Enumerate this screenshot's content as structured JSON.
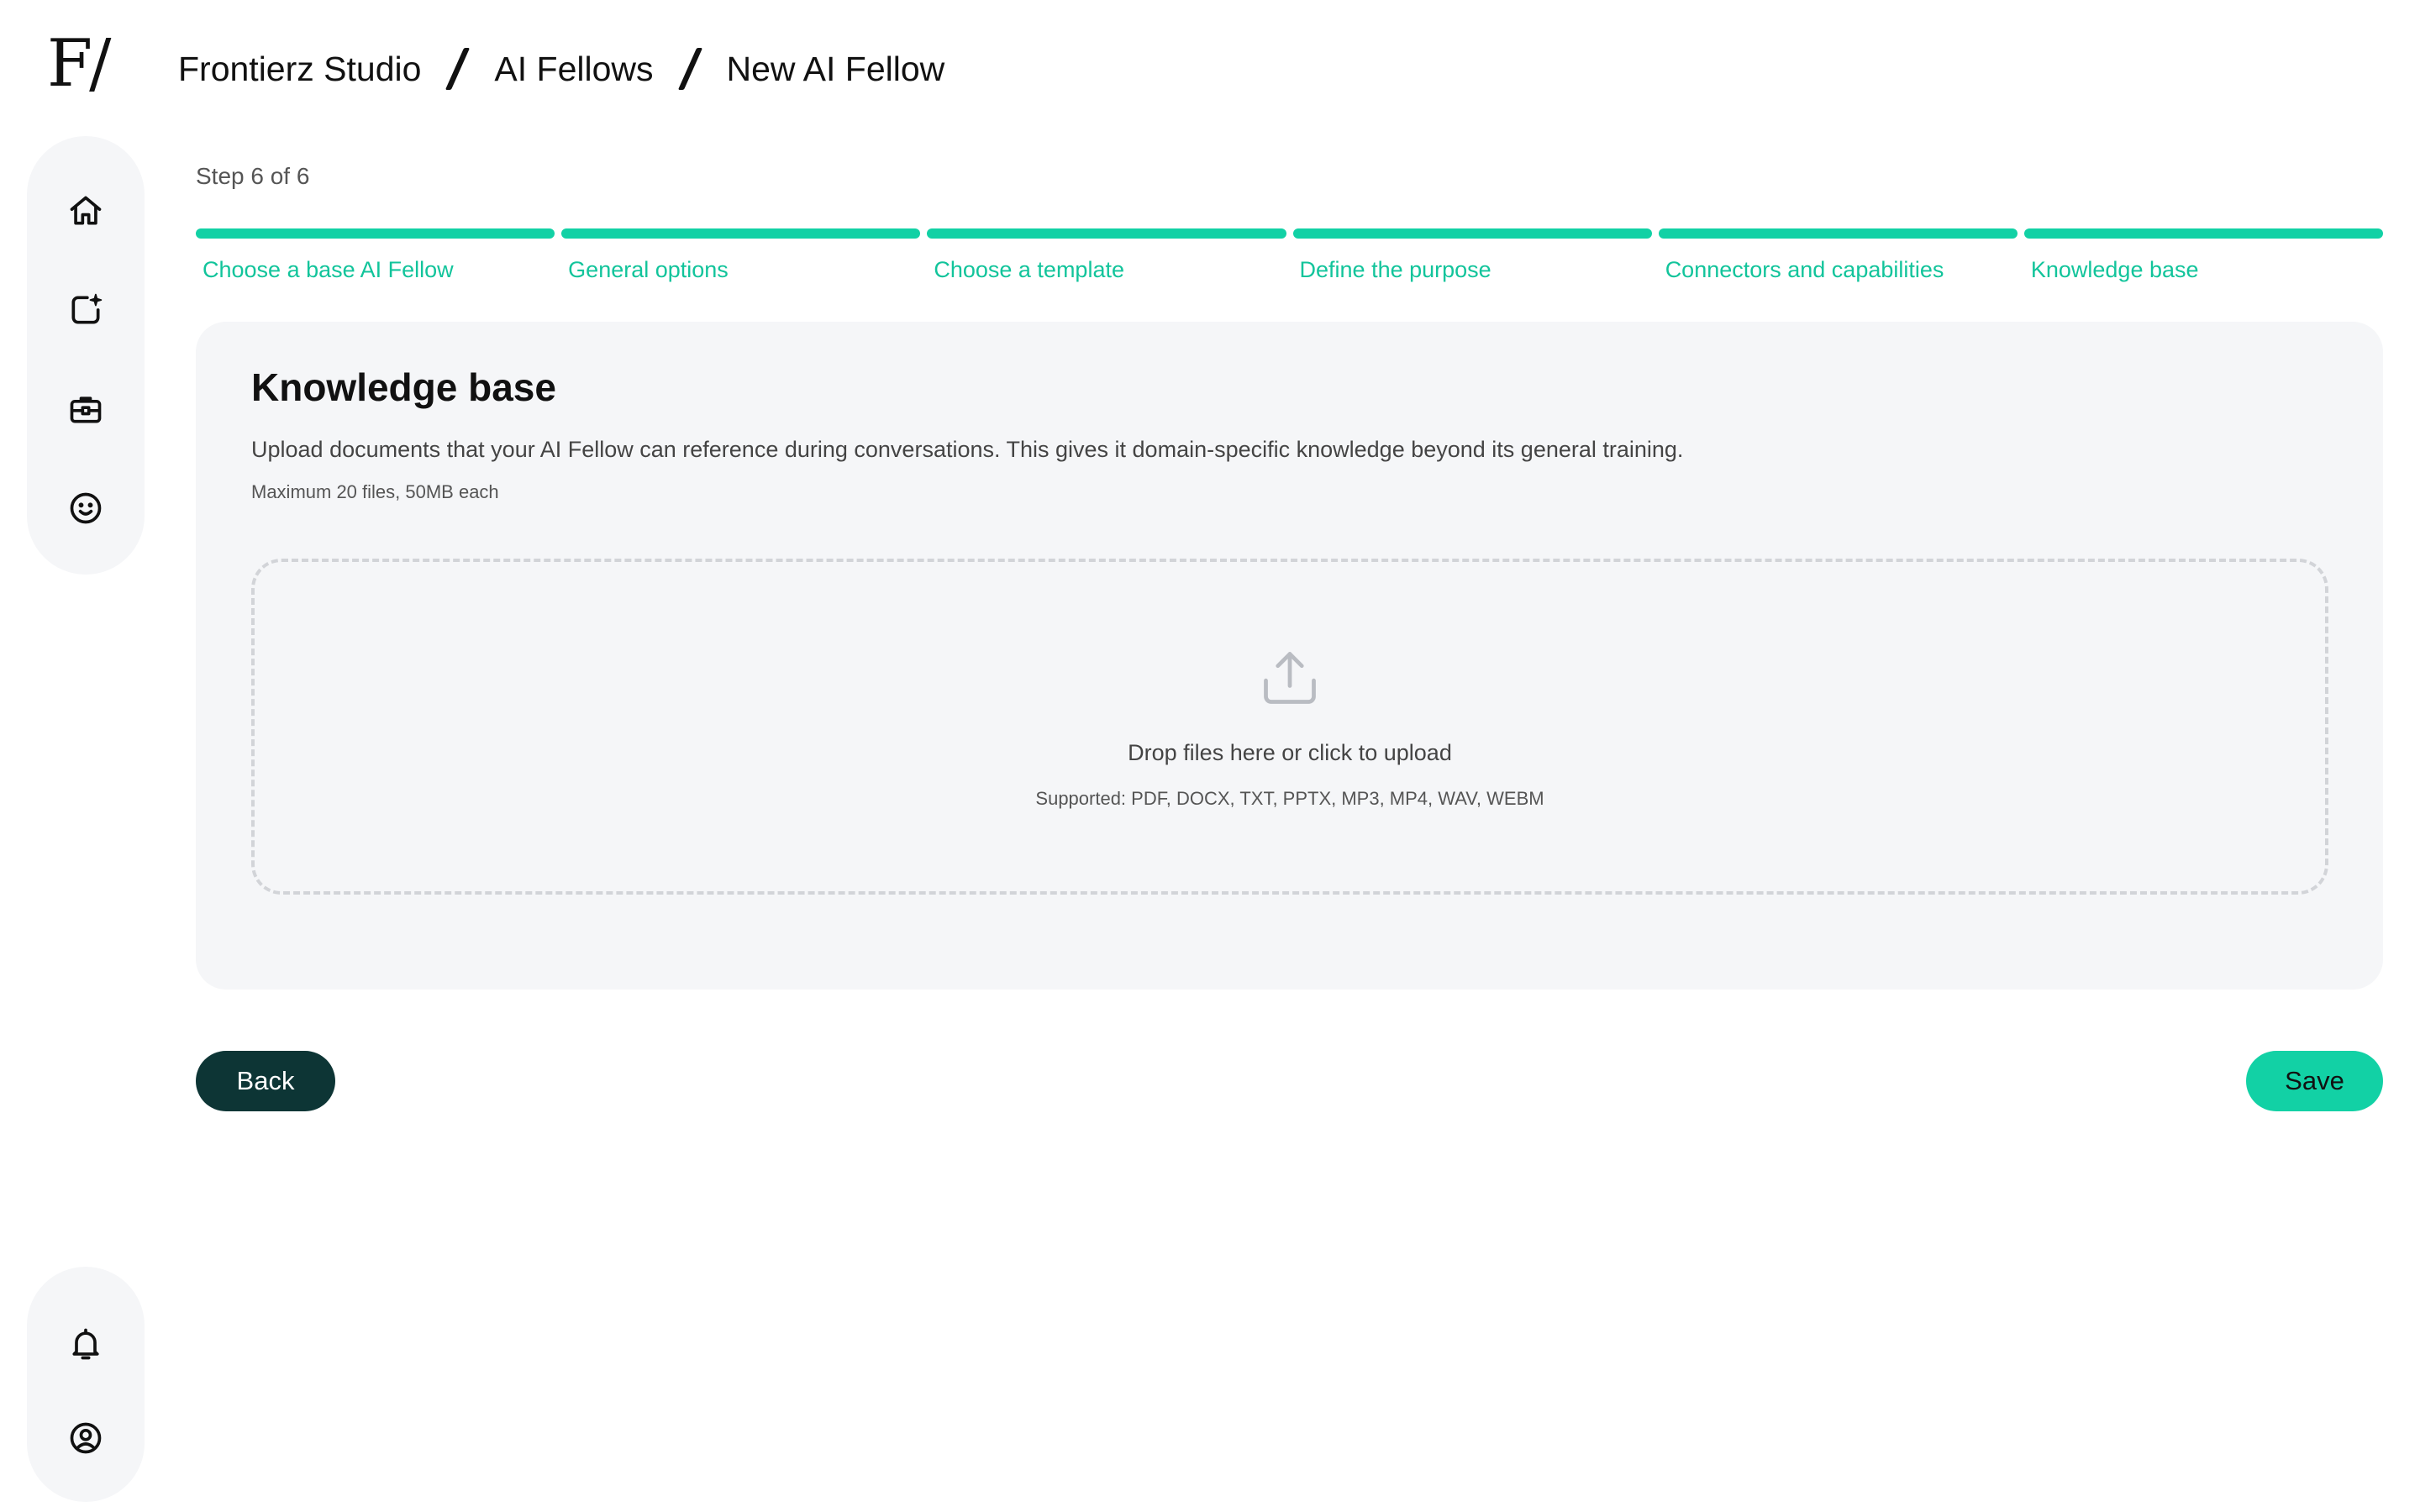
{
  "header": {
    "logo_text": "F/",
    "breadcrumbs": [
      "Frontierz Studio",
      "AI Fellows",
      "New AI Fellow"
    ]
  },
  "sidebar": {
    "top_icons": [
      "home-icon",
      "sparkle-tab-icon",
      "briefcase-icon",
      "smiley-icon"
    ],
    "bottom_icons": [
      "bell-icon",
      "user-circle-icon"
    ]
  },
  "wizard": {
    "step_counter": "Step 6 of 6",
    "steps": [
      {
        "label": "Choose a base AI Fellow"
      },
      {
        "label": "General options"
      },
      {
        "label": "Choose a template"
      },
      {
        "label": "Define the purpose"
      },
      {
        "label": "Connectors and capabilities"
      },
      {
        "label": "Knowledge base"
      }
    ]
  },
  "knowledge_base": {
    "title": "Knowledge base",
    "description": "Upload documents that your AI Fellow can reference during conversations. This gives it domain-specific knowledge beyond its general training.",
    "limit_note": "Maximum 20 files, 50MB each",
    "dropzone": {
      "icon": "upload-icon",
      "text": "Drop files here or click to upload",
      "supported": "Supported: PDF, DOCX, TXT, PPTX, MP3, MP4, WAV, WEBM"
    }
  },
  "actions": {
    "back_label": "Back",
    "save_label": "Save"
  },
  "colors": {
    "accent": "#12d1a5",
    "accent_text": "#12c49b",
    "dark_button": "#0d3535",
    "panel_bg": "#f5f6f8"
  }
}
